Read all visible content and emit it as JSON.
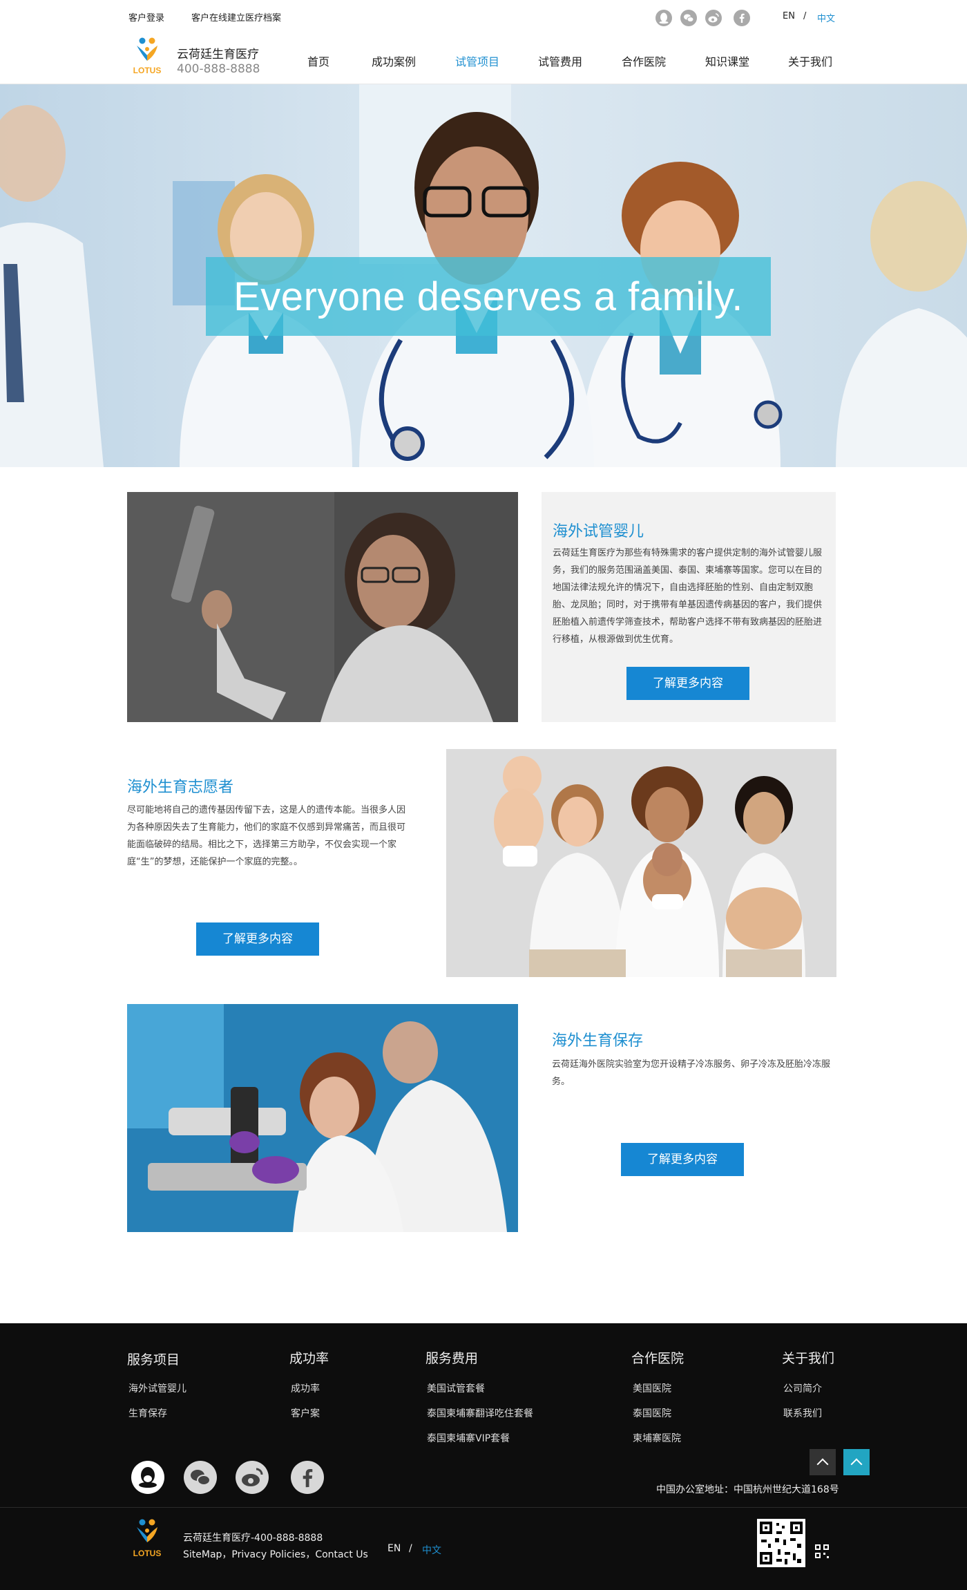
{
  "topbar": {
    "login": "客户登录",
    "records": "客户在线建立医疗档案",
    "lang_en": "EN",
    "lang_sep": "/",
    "lang_cn": "中文"
  },
  "header": {
    "brand_name": "云荷廷生育医疗",
    "phone": "400-888-8888",
    "logo_text": "LOTUS"
  },
  "nav": [
    {
      "label": "首页",
      "active": false
    },
    {
      "label": "成功案例",
      "active": false
    },
    {
      "label": "试管项目",
      "active": true
    },
    {
      "label": "试管费用",
      "active": false
    },
    {
      "label": "合作医院",
      "active": false
    },
    {
      "label": "知识课堂",
      "active": false
    },
    {
      "label": "关于我们",
      "active": false
    }
  ],
  "hero": {
    "headline": "Everyone deserves a family."
  },
  "sections": [
    {
      "title": "海外试管婴儿",
      "body": "云荷廷生育医疗为那些有特殊需求的客户提供定制的海外试管婴儿服务，我们的服务范围涵盖美国、泰国、柬埔寨等国家。您可以在目的地国法律法规允许的情况下，自由选择胚胎的性别、自由定制双胞胎、龙凤胎；同时，对于携带有单基因遗传病基因的客户，我们提供胚胎植入前遗传学筛查技术，帮助客户选择不带有致病基因的胚胎进行移植，从根源做到优生优育。",
      "button": "了解更多内容"
    },
    {
      "title": "海外生育志愿者",
      "body": "尽可能地将自己的遗传基因传留下去，这是人的遗传本能。当很多人因为各种原因失去了生育能力，他们的家庭不仅感到异常痛苦，而且很可能面临破碎的结局。相比之下，选择第三方助孕，不仅会实现一个家庭“生”的梦想，还能保护一个家庭的完整。。",
      "button": "了解更多内容"
    },
    {
      "title": "海外生育保存",
      "body": "云荷廷海外医院实验室为您开设精子冷冻服务、卵子冷冻及胚胎冷冻服务。",
      "button": "了解更多内容"
    }
  ],
  "footer": {
    "columns": [
      {
        "title": "服务项目",
        "links": [
          "海外试管婴儿",
          "生育保存"
        ]
      },
      {
        "title": "成功率",
        "links": [
          "成功率",
          "客户案"
        ]
      },
      {
        "title": "服务费用",
        "links": [
          "美国试管套餐",
          "泰国柬埔寨翻译吃住套餐",
          "泰国柬埔寨VIP套餐"
        ]
      },
      {
        "title": "合作医院",
        "links": [
          "美国医院",
          "泰国医院",
          "柬埔寨医院"
        ]
      },
      {
        "title": "关于我们",
        "links": [
          "公司简介",
          "联系我们"
        ]
      }
    ],
    "address": "中国办公室地址：中国杭州世纪大道168号",
    "brand_line": "云荷廷生育医疗-400-888-8888",
    "policy_line": "SiteMap，Privacy Policies，Contact Us",
    "lang_en": "EN",
    "lang_sep": "/",
    "lang_cn": "中文",
    "logo_text": "LOTUS"
  },
  "colors": {
    "accent": "#1e8fd0",
    "button": "#1687d3",
    "footer_bg": "#0d0d0d",
    "hero_banner": "#40bed7",
    "back_top_teal": "#22a5c2"
  },
  "icons": {
    "topbar_social": [
      "qq-icon",
      "wechat-icon",
      "weibo-icon",
      "facebook-icon"
    ],
    "footer_social": [
      "qq-icon",
      "wechat-icon",
      "weibo-icon",
      "facebook-icon"
    ]
  }
}
